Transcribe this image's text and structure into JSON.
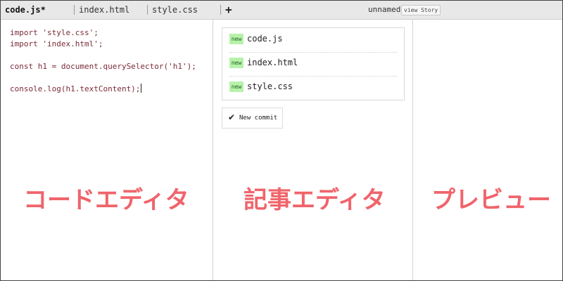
{
  "tabs": [
    {
      "label": "code.js*",
      "active": true
    },
    {
      "label": "index.html",
      "active": false
    },
    {
      "label": "style.css",
      "active": false
    }
  ],
  "add_tab_icon": "plus-icon",
  "add_tab_glyph": "+",
  "project": {
    "name": "unnamed",
    "view_story_label": "view Story"
  },
  "code_lines": [
    "import 'style.css';",
    "import 'index.html';",
    "",
    "const h1 = document.querySelector('h1');",
    "",
    "console.log(h1.textContent);"
  ],
  "files": [
    {
      "badge": "new",
      "name": "code.js"
    },
    {
      "badge": "new",
      "name": "index.html"
    },
    {
      "badge": "new",
      "name": "style.css"
    }
  ],
  "commit": {
    "icon": "check-icon",
    "glyph": "✔",
    "label": "New commit"
  },
  "pane_labels": {
    "code_editor": "コードエディタ",
    "article_editor": "記事エディタ",
    "preview": "プレビュー"
  },
  "colors": {
    "pane_label": "#f0646b",
    "new_badge_bg": "#b6f2a9",
    "code_text": "#7a2b38",
    "topbar_bg": "#e8e8e8"
  }
}
